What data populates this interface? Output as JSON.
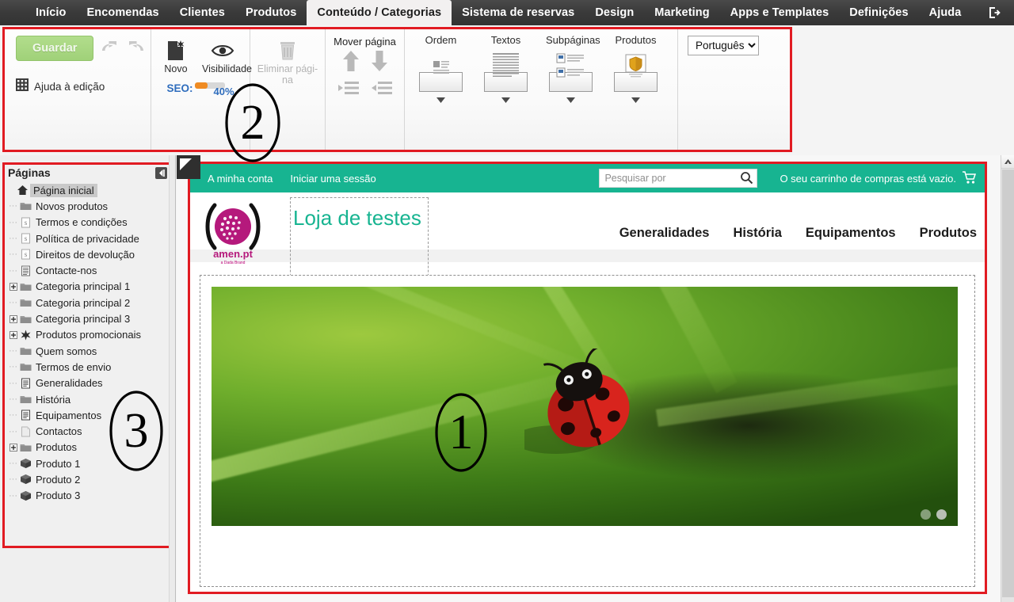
{
  "topmenu": {
    "items": [
      {
        "label": "Início",
        "active": false
      },
      {
        "label": "Encomendas",
        "active": false
      },
      {
        "label": "Clientes",
        "active": false
      },
      {
        "label": "Produtos",
        "active": false
      },
      {
        "label": "Conteúdo / Categorias",
        "active": true
      },
      {
        "label": "Sistema de reservas",
        "active": false
      },
      {
        "label": "Design",
        "active": false
      },
      {
        "label": "Marketing",
        "active": false
      },
      {
        "label": "Apps e Templates",
        "active": false
      },
      {
        "label": "Definições",
        "active": false
      },
      {
        "label": "Ajuda",
        "active": false
      }
    ],
    "logout_icon": "logout-icon"
  },
  "ribbon": {
    "save_label": "Guardar",
    "undo_icon": "undo-arrow-icon",
    "redo_icon": "redo-arrow-icon",
    "help_label": "Ajuda à edição",
    "help_icon": "grid-icon",
    "new_label": "Novo",
    "new_icon": "new-page-icon",
    "visibility_label": "Visibilidade",
    "visibility_icon": "eye-icon",
    "seo_label": "SEO:",
    "seo_percent": "40%",
    "seo_value": 40,
    "delete_label": "Eliminar pági-na",
    "delete_icon": "trash-icon",
    "move_label": "Mover página",
    "move_up_icon": "arrow-up-icon",
    "move_down_icon": "arrow-down-icon",
    "outdent_icon": "outdent-icon",
    "indent_icon": "indent-icon",
    "templates": [
      {
        "name": "Ordem",
        "icon": "layout-order-icon"
      },
      {
        "name": "Textos",
        "icon": "layout-text-icon"
      },
      {
        "name": "Subpáginas",
        "icon": "layout-subpages-icon"
      },
      {
        "name": "Produtos",
        "icon": "layout-products-icon"
      }
    ],
    "language_selected": "Português",
    "language_options": [
      "Português"
    ]
  },
  "sidebar": {
    "title": "Páginas",
    "collapse_icon": "collapse-panel-icon",
    "nodes": [
      {
        "label": "Página inicial",
        "icon": "home-icon",
        "indent": 0,
        "expander": "none",
        "selected": true
      },
      {
        "label": "Novos produtos",
        "icon": "folder-icon",
        "indent": 1,
        "expander": "none",
        "selected": false
      },
      {
        "label": "Termos e condições",
        "icon": "script-page-icon",
        "indent": 1,
        "expander": "none",
        "selected": false
      },
      {
        "label": "Política de privacidade",
        "icon": "script-page-icon",
        "indent": 1,
        "expander": "none",
        "selected": false
      },
      {
        "label": "Direitos de devolução",
        "icon": "script-page-icon",
        "indent": 1,
        "expander": "none",
        "selected": false
      },
      {
        "label": "Contacte-nos",
        "icon": "form-page-icon",
        "indent": 1,
        "expander": "none",
        "selected": false
      },
      {
        "label": "Categoria principal 1",
        "icon": "folder-icon",
        "indent": 1,
        "expander": "plus",
        "selected": false
      },
      {
        "label": "Categoria principal 2",
        "icon": "folder-icon",
        "indent": 1,
        "expander": "none",
        "selected": false
      },
      {
        "label": "Categoria principal 3",
        "icon": "folder-icon",
        "indent": 1,
        "expander": "plus",
        "selected": false
      },
      {
        "label": "Produtos promocionais",
        "icon": "star-icon",
        "indent": 1,
        "expander": "plus",
        "selected": false
      },
      {
        "label": "Quem somos",
        "icon": "folder-icon",
        "indent": 1,
        "expander": "none",
        "selected": false
      },
      {
        "label": "Termos de envio",
        "icon": "folder-icon",
        "indent": 1,
        "expander": "none",
        "selected": false
      },
      {
        "label": "Generalidades",
        "icon": "text-page-icon",
        "indent": 1,
        "expander": "none",
        "selected": false
      },
      {
        "label": "História",
        "icon": "folder-icon",
        "indent": 1,
        "expander": "none",
        "selected": false
      },
      {
        "label": "Equipamentos",
        "icon": "text-page-icon",
        "indent": 1,
        "expander": "none",
        "selected": false
      },
      {
        "label": "Contactos",
        "icon": "blank-page-icon",
        "indent": 1,
        "expander": "none",
        "selected": false
      },
      {
        "label": "Produtos",
        "icon": "folder-icon",
        "indent": 1,
        "expander": "plus",
        "selected": false
      },
      {
        "label": "Produto 1",
        "icon": "product-box-icon",
        "indent": 1,
        "expander": "none",
        "selected": false
      },
      {
        "label": "Produto 2",
        "icon": "product-box-icon",
        "indent": 1,
        "expander": "none",
        "selected": false
      },
      {
        "label": "Produto 3",
        "icon": "product-box-icon",
        "indent": 1,
        "expander": "none",
        "selected": false
      }
    ]
  },
  "preview": {
    "topbar": {
      "account_link": "A minha conta",
      "login_link": "Iniciar uma sessão",
      "search_placeholder": "Pesquisar por",
      "search_value": "",
      "search_icon": "search-icon",
      "cart_text": "O seu carrinho de compras está vazio.",
      "cart_icon": "shopping-cart-icon"
    },
    "logo_text": "amen.pt",
    "logo_sub": "a Dada Brand",
    "site_title": "Loja de testes",
    "nav": [
      "Generalidades",
      "História",
      "Equipamentos",
      "Produtos"
    ],
    "slider": {
      "image_alt": "ladybug-on-green-grass",
      "dots": 2,
      "active_dot": 2
    }
  },
  "annotations": [
    {
      "id": "1",
      "label": "1"
    },
    {
      "id": "2",
      "label": "2"
    },
    {
      "id": "3",
      "label": "3"
    }
  ],
  "colors": {
    "accent_teal": "#17b491",
    "annotation_red": "#e11b22",
    "menu_dark": "#3a3a3a",
    "save_green": "#a9d683",
    "seo_orange": "#ef8b22",
    "seo_blue": "#2f6dbd",
    "logo_magenta": "#b5197c"
  },
  "scrollbar": {
    "up_icon": "scroll-up-icon"
  }
}
